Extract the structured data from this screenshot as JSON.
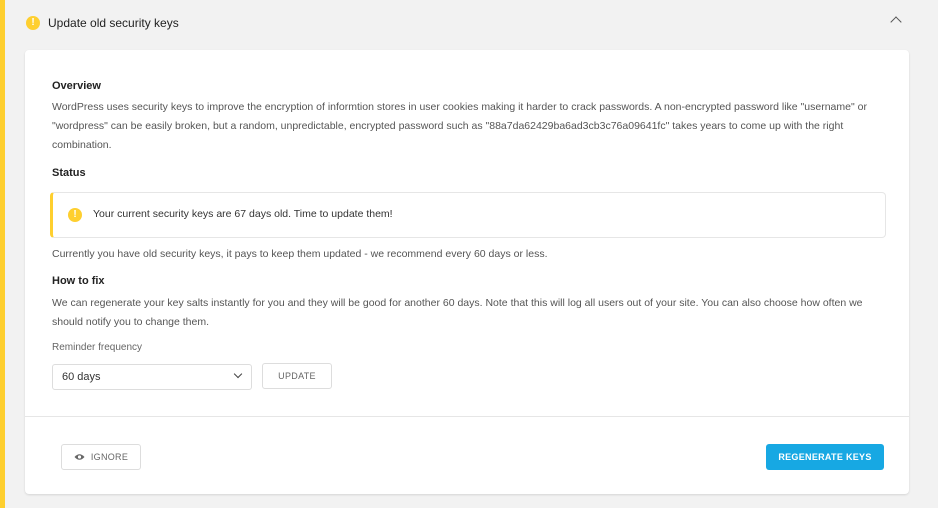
{
  "header": {
    "title": "Update old security keys",
    "icon": "warning-icon"
  },
  "overview": {
    "heading": "Overview",
    "text": "WordPress uses security keys to improve the encryption of informtion stores in user cookies making it harder to crack passwords. A non-encrypted password like \"username\" or \"wordpress\" can be easily broken, but a random, unpredictable, encrypted password such as \"88a7da62429ba6ad3cb3c76a09641fc\" takes years to come up with the right combination."
  },
  "status": {
    "heading": "Status",
    "notice": "Your current security keys are 67 days old. Time to update them!",
    "description": "Currently you have old security keys, it pays to keep them updated - we recommend every 60 days or less."
  },
  "how_to_fix": {
    "heading": "How to fix",
    "text": "We can regenerate your key salts instantly for you and they will be good for another 60 days. Note that this will log all users out of your site. You can also choose how often we should notify you to change them."
  },
  "reminder": {
    "label": "Reminder frequency",
    "selected": "60 days",
    "update_label": "UPDATE"
  },
  "footer": {
    "ignore_label": "IGNORE",
    "regenerate_label": "REGENERATE KEYS"
  },
  "colors": {
    "accent_warning": "#fecf2f",
    "primary_button": "#17a8e3"
  }
}
